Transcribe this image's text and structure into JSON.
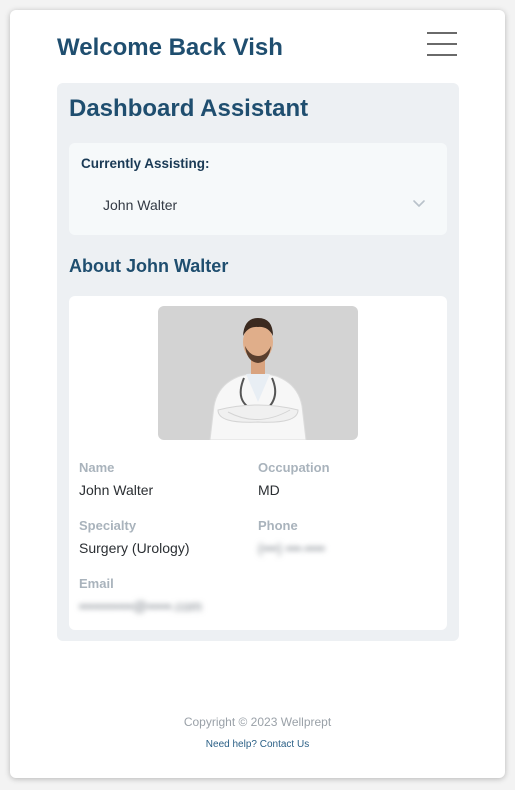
{
  "header": {
    "welcome": "Welcome Back Vish",
    "menu_icon": "hamburger-menu-icon"
  },
  "panel": {
    "title": "Dashboard Assistant",
    "assisting": {
      "label": "Currently Assisting:",
      "selected": "John Walter",
      "icon": "chevron-down-icon"
    },
    "about_title": "About John Walter"
  },
  "profile": {
    "photo": "doctor-profile-photo",
    "fields": {
      "name": {
        "label": "Name",
        "value": "John Walter"
      },
      "occupation": {
        "label": "Occupation",
        "value": "MD"
      },
      "specialty": {
        "label": "Specialty",
        "value": "Surgery (Urology)"
      },
      "phone": {
        "label": "Phone",
        "value": "(•••) •••-••••"
      },
      "email": {
        "label": "Email",
        "value": "•••••••••••@•••••.com"
      }
    }
  },
  "footer": {
    "copyright": "Copyright © 2023 Wellprept",
    "help": "Need help? Contact Us"
  },
  "colors": {
    "heading": "#1f4e6f",
    "panel_bg": "#edf0f3",
    "label": "#a9b3bc",
    "link": "#2a5f86"
  }
}
